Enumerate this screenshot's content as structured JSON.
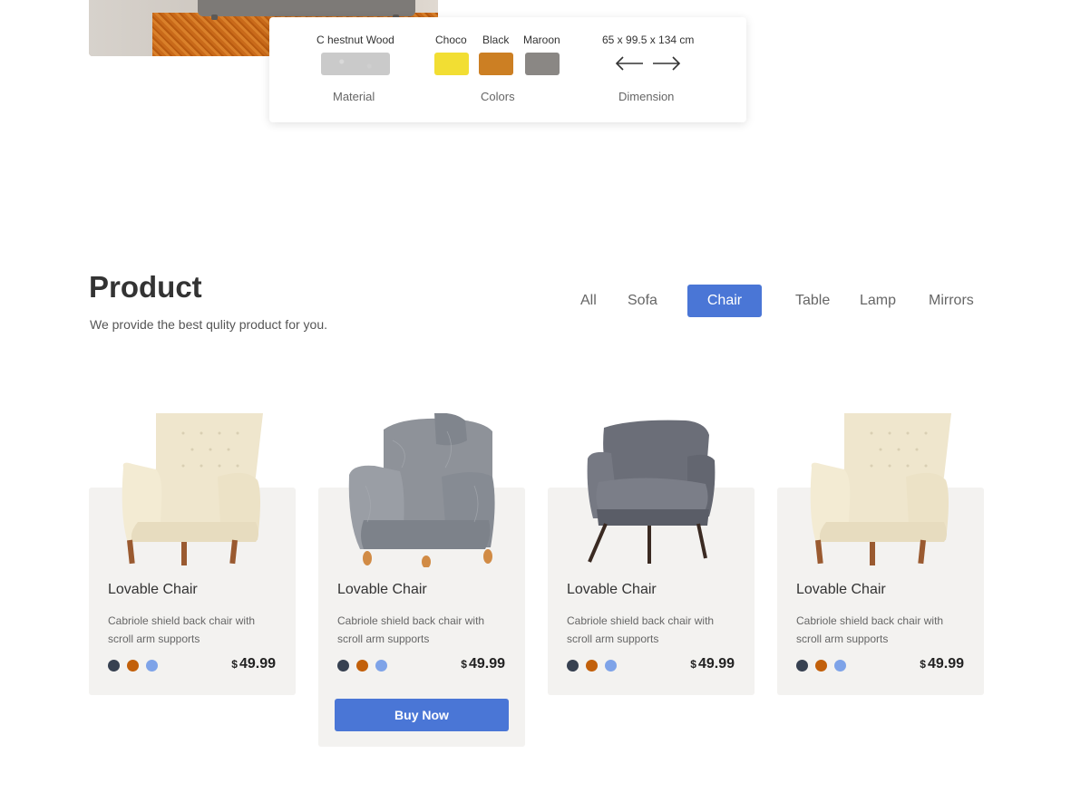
{
  "spec": {
    "material_name": "C hestnut Wood",
    "material_label": "Material",
    "colors": [
      {
        "name": "Choco",
        "hex": "#f2de33"
      },
      {
        "name": "Black",
        "hex": "#cc7f23"
      },
      {
        "name": "Maroon",
        "hex": "#8a8784"
      }
    ],
    "colors_label": "Colors",
    "dimension_value": "65 x 99.5 x 134 cm",
    "dimension_label": "Dimension"
  },
  "product": {
    "title": "Product",
    "subtitle": "We provide the best  qulity product for you.",
    "filters": [
      "All",
      "Sofa",
      "Chair",
      "Table",
      "Lamp",
      "Mirrors"
    ],
    "active_filter": "Chair"
  },
  "cards": [
    {
      "title": "Lovable Chair",
      "desc": "Cabriole shield back chair with scroll arm supports",
      "currency": "$",
      "price": "49.99",
      "chair": "cream-leather"
    },
    {
      "title": "Lovable Chair",
      "desc": "Cabriole shield back chair with scroll arm supports",
      "currency": "$",
      "price": "49.99",
      "chair": "grey-fur",
      "button": "Buy Now"
    },
    {
      "title": "Lovable Chair",
      "desc": "Cabriole shield back chair with scroll arm supports",
      "currency": "$",
      "price": "49.99",
      "chair": "grey-modern"
    },
    {
      "title": "Lovable Chair",
      "desc": "Cabriole shield back chair with scroll arm supports",
      "currency": "$",
      "price": "49.99",
      "chair": "cream-leather"
    }
  ],
  "swatch_colors": [
    "#374151",
    "#c2600b",
    "#7ea3e8"
  ],
  "accent": "#4a76d6"
}
